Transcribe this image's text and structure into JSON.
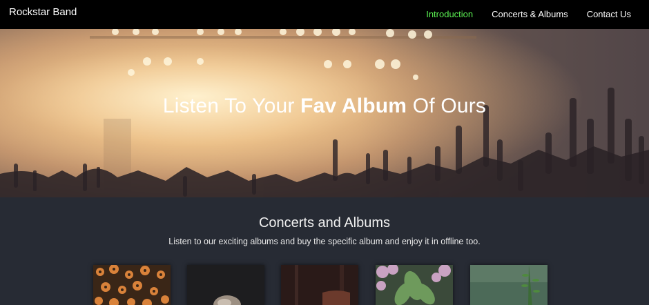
{
  "navbar": {
    "brand": "Rockstar Band",
    "links": [
      {
        "label": "Introduction",
        "active": true
      },
      {
        "label": "Concerts & Albums",
        "active": false
      },
      {
        "label": "Contact Us",
        "active": false
      }
    ],
    "active_color": "#5bf052"
  },
  "hero": {
    "title_part1": "Listen To Your ",
    "title_bold": "Fav Album",
    "title_part2": " Of Ours"
  },
  "section": {
    "title": "Concerts and Albums",
    "subtitle": "Listen to our exciting albums and buy the specific album and enjoy it in offline too."
  },
  "albums": [
    {
      "image": "orange-flowers"
    },
    {
      "image": "bearded-man"
    },
    {
      "image": "dark-forest-figure"
    },
    {
      "image": "pink-hydrangea-plant"
    },
    {
      "image": "green-foliage"
    }
  ]
}
